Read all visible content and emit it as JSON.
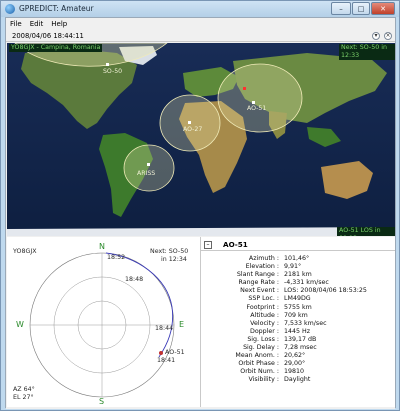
{
  "window": {
    "title": "GPREDICT: Amateur",
    "minimize": "–",
    "maximize": "□",
    "close": "✕"
  },
  "menu": [
    "File",
    "Edit",
    "Help"
  ],
  "module": {
    "time": "2008/04/06 18:44:11",
    "btn_a": "▾",
    "btn_b": "×"
  },
  "map": {
    "qth_label": "YO8GJX - Campina, Romania",
    "next_event": "Next: SO-50  in 12:33",
    "status": "AO-51  LOS in 09:13",
    "satellites": [
      {
        "name": "SO-50"
      },
      {
        "name": "AO-27"
      },
      {
        "name": "AO-51"
      },
      {
        "name": "ARISS"
      }
    ],
    "colors": {
      "ocean": "#13254a",
      "land": "#2f6a2b",
      "footprint": "#e8e4a8"
    }
  },
  "polar": {
    "qth": "YO8GJX",
    "next": "Next: SO-50",
    "next_in": "in 12:34",
    "dir_n": "N",
    "dir_s": "S",
    "dir_e": "E",
    "dir_w": "W",
    "az": "AZ 64°",
    "el": "EL 27°",
    "track_times": [
      "18:52",
      "18:48",
      "18:44",
      "18:41"
    ],
    "sat_label": "AO-51"
  },
  "info": {
    "toggle": "–",
    "sat_name": "AO-51",
    "rows": [
      {
        "k": "Azimuth :",
        "v": "101,46°"
      },
      {
        "k": "Elevation :",
        "v": "9,91°"
      },
      {
        "k": "Slant Range :",
        "v": "2181 km"
      },
      {
        "k": "Range Rate :",
        "v": "-4,331 km/sec"
      },
      {
        "k": "Next Event :",
        "v": "LOS: 2008/04/06 18:53:25"
      },
      {
        "k": "SSP Loc. :",
        "v": "LM49DG"
      },
      {
        "k": "Footprint :",
        "v": "5755 km"
      },
      {
        "k": "Altitude :",
        "v": "709 km"
      },
      {
        "k": "Velocity :",
        "v": "7,533 km/sec"
      },
      {
        "k": "Doppler :",
        "v": "1445 Hz"
      },
      {
        "k": "Sig. Loss :",
        "v": "139,17 dB"
      },
      {
        "k": "Sig. Delay :",
        "v": "7,28 msec"
      },
      {
        "k": "Mean Anom. :",
        "v": "20,62°"
      },
      {
        "k": "Orbit Phase :",
        "v": "29,00°"
      },
      {
        "k": "Orbit Num. :",
        "v": "19810"
      },
      {
        "k": "Visibility :",
        "v": "Daylight"
      }
    ]
  }
}
